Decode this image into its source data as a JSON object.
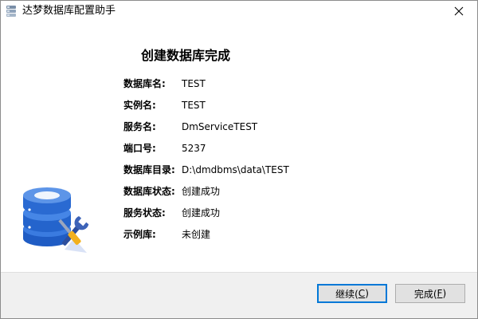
{
  "window": {
    "title": "达梦数据库配置助手",
    "close_glyph": "✕"
  },
  "main": {
    "heading": "创建数据库完成",
    "info": [
      {
        "label": "数据库名:",
        "value": "TEST"
      },
      {
        "label": "实例名:",
        "value": "TEST"
      },
      {
        "label": "服务名:",
        "value": "DmServiceTEST"
      },
      {
        "label": "端口号:",
        "value": "5237"
      },
      {
        "label": "数据库目录:",
        "value": "D:\\dmdbms\\data\\TEST"
      },
      {
        "label": "数据库状态:",
        "value": "创建成功"
      },
      {
        "label": "服务状态:",
        "value": "创建成功"
      },
      {
        "label": "示例库:",
        "value": "未创建"
      }
    ]
  },
  "footer": {
    "next": {
      "text": "继续(",
      "key": "C",
      "end": ")"
    },
    "finish": {
      "text": "完成(",
      "key": "F",
      "end": ")"
    }
  },
  "colors": {
    "db_blue": "#2f6fd1",
    "db_light": "#5d95e8",
    "accent": "#0078d7"
  },
  "icons": {
    "app": "database-stack-icon",
    "close": "close-icon",
    "illustration": "database-wrench-icon"
  }
}
